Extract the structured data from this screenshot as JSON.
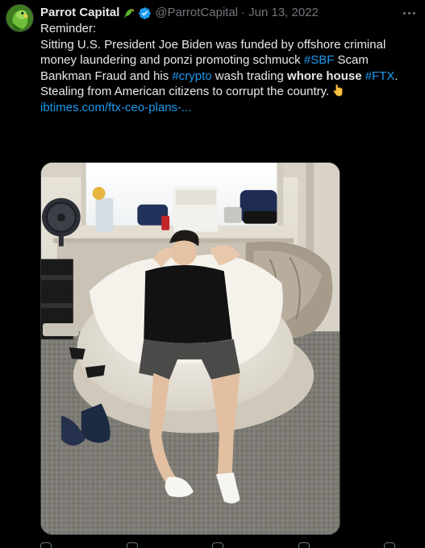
{
  "tweet": {
    "author_name": "Parrot Capital",
    "author_emoji": "parrot-emoji",
    "verified_icon": "verified-badge-icon",
    "handle": "@ParrotCapital",
    "separator": "·",
    "date": "Jun 13, 2022",
    "more_icon": "more-options-icon",
    "avatar": "parrot-avatar",
    "text": {
      "p1": "Reminder:",
      "p2_a": "Sitting U.S. President Joe Biden was funded by offshore criminal money laundering and ponzi promoting schmuck ",
      "p2_tag1": "#SBF",
      "p2_b": " Scam Bankman Fraud and his ",
      "p2_tag2": "#crypto",
      "p2_c": " wash trading ",
      "p2_bold": "whore house",
      "p2_d": " ",
      "p2_tag3": "#FTX",
      "p2_e": ".",
      "p3": "Stealing from American citizens to corrupt the country.",
      "p3_emoji": "pointing-down-emoji",
      "link": "ibtimes.com/ftx-ceo-plans-..."
    },
    "media": {
      "kind": "photo",
      "description_icon": "photo-of-man-on-beanbag"
    },
    "actions": [
      {
        "name": "reply-icon"
      },
      {
        "name": "retweet-icon"
      },
      {
        "name": "like-icon"
      },
      {
        "name": "views-icon"
      },
      {
        "name": "share-icon"
      }
    ]
  },
  "colors": {
    "background": "#000000",
    "text": "#e7e9ea",
    "muted": "#71767b",
    "link": "#1d9bf0",
    "verified": "#1d9bf0"
  }
}
